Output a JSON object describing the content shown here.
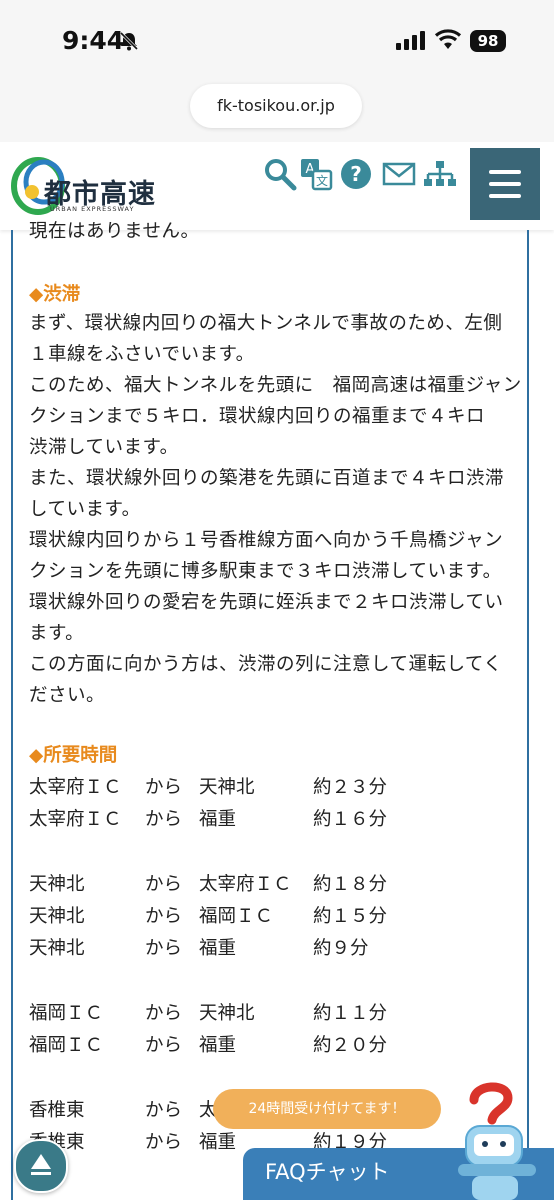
{
  "status_bar": {
    "time": "9:44",
    "battery": "98"
  },
  "browser": {
    "url": "fk-tosikou.or.jp"
  },
  "header": {
    "logo_title": "都市高速",
    "logo_subtitle": "URBAN EXPRESSWAY"
  },
  "content": {
    "partial_text": "現在はありません。",
    "congestion": {
      "heading": "◆渋滞",
      "lines": [
        "まず、環状線内回りの福大トンネルで事故のため、左側",
        "１車線をふさいでいます。",
        "このため、福大トンネルを先頭に　福岡高速は福重ジャン",
        "クションまで５キロ．環状線内回りの福重まで４キロ",
        "渋滞しています。",
        "また、環状線外回りの築港を先頭に百道まで４キロ渋滞",
        "しています。",
        "環状線内回りから１号香椎線方面へ向かう千鳥橋ジャン",
        "クションを先頭に博多駅東まで３キロ渋滞しています。",
        "環状線外回りの愛宕を先頭に姪浜まで２キロ渋滞してい",
        "ます。",
        "この方面に向かう方は、渋滞の列に注意して運転してく",
        "ださい。"
      ]
    },
    "travel_time": {
      "heading": "◆所要時間",
      "rows": [
        {
          "from": "太宰府ＩＣ",
          "kara": "から",
          "to": "天神北",
          "time": "約２３分"
        },
        {
          "from": "太宰府ＩＣ",
          "kara": "から",
          "to": "福重",
          "time": "約１６分"
        },
        {
          "from": "天神北",
          "kara": "から",
          "to": "太宰府ＩＣ",
          "time": "約１８分"
        },
        {
          "from": "天神北",
          "kara": "から",
          "to": "福岡ＩＣ",
          "time": "約１５分"
        },
        {
          "from": "天神北",
          "kara": "から",
          "to": "福重",
          "time": "約９分"
        },
        {
          "from": "福岡ＩＣ",
          "kara": "から",
          "to": "天神北",
          "time": "約１１分"
        },
        {
          "from": "福岡ＩＣ",
          "kara": "から",
          "to": "福重",
          "time": "約２０分"
        },
        {
          "from": "香椎東",
          "kara": "から",
          "to": "太",
          "time": ""
        },
        {
          "from": "香椎東",
          "kara": "から",
          "to": "福重",
          "time": "約１９分"
        }
      ]
    }
  },
  "chat": {
    "bubble": "24時間受け付けてます！",
    "faq_label": "FAQチャット"
  },
  "colors": {
    "accent_orange": "#e88a1d",
    "border_blue": "#2f6fa0",
    "menu_teal": "#3a6677",
    "faq_blue": "#3a7fb8"
  }
}
